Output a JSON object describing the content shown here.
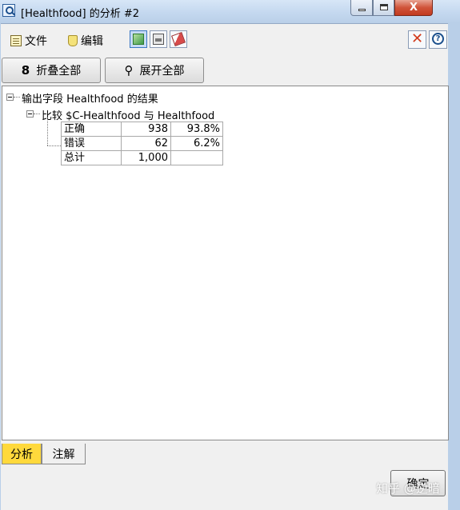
{
  "window": {
    "title": "[Healthfood] 的分析 #2",
    "controls": {
      "close_glyph": "X"
    }
  },
  "menubar": {
    "file_label": "文件",
    "edit_label": "编辑",
    "tool_icons": [
      "generate-node-icon",
      "print-icon",
      "export-icon"
    ]
  },
  "toolbar": {
    "collapse_all_label": "折叠全部",
    "expand_all_label": "展开全部"
  },
  "tree": {
    "root_label": "输出字段 Healthfood 的结果",
    "child_label": "比较 $C-Healthfood 与 Healthfood",
    "rows": [
      {
        "label": "正确",
        "count": "938",
        "percent": "93.8%"
      },
      {
        "label": "错误",
        "count": "62",
        "percent": "6.2%"
      },
      {
        "label": "总计",
        "count": "1,000",
        "percent": ""
      }
    ]
  },
  "tabs": [
    {
      "label": "分析",
      "active": true
    },
    {
      "label": "注解",
      "active": false
    }
  ],
  "footer": {
    "ok_label": "确定",
    "watermark": "知乎 @逆暗"
  },
  "colors": {
    "active_tab": "#ffd93c",
    "close_button": "#c23a1f"
  }
}
